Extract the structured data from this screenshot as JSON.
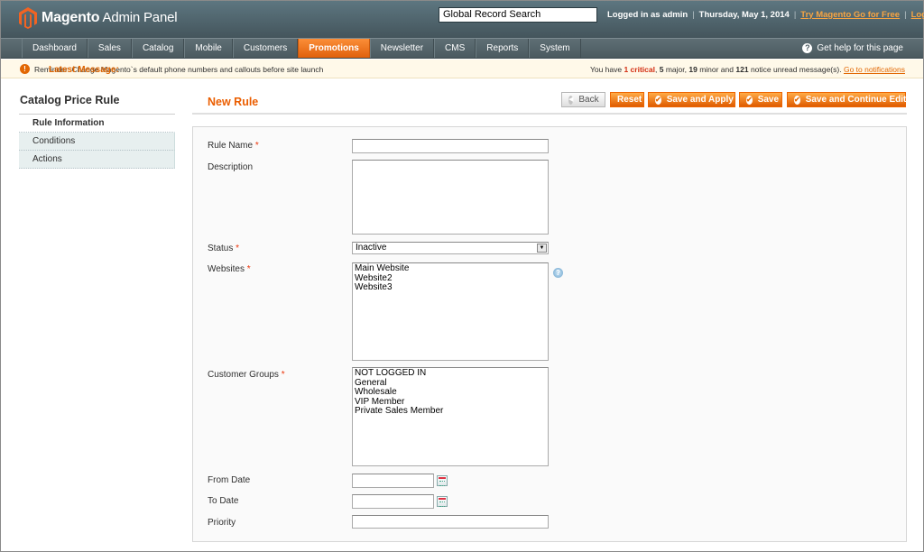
{
  "header": {
    "logo_brand": "Magento",
    "logo_suffix": "Admin Panel",
    "search_value": "Global Record Search",
    "logged_in": "Logged in as admin",
    "date": "Thursday, May 1, 2014",
    "try_link": "Try Magento Go for Free",
    "logout": "Log Out",
    "brand_color": "#eb5e00"
  },
  "nav": {
    "items": [
      "Dashboard",
      "Sales",
      "Catalog",
      "Mobile",
      "Customers",
      "Promotions",
      "Newsletter",
      "CMS",
      "Reports",
      "System"
    ],
    "active": "Promotions",
    "help": "Get help for this page"
  },
  "notice": {
    "label": "Latest Message:",
    "message": "Reminder: Change Magento`s default phone numbers and callouts before site launch",
    "summary_prefix": "You have",
    "critical_count": "1 critical",
    "major_count": "5",
    "major_label": "major,",
    "minor_count": "19",
    "minor_label": "minor and",
    "notice_count": "121",
    "notice_label": "notice unread message(s).",
    "link": "Go to notifications"
  },
  "sidebar": {
    "title": "Catalog Price Rule",
    "tabs": [
      "Rule Information",
      "Conditions",
      "Actions"
    ]
  },
  "content": {
    "title": "New Rule",
    "buttons": {
      "back": "Back",
      "reset": "Reset",
      "save_apply": "Save and Apply",
      "save": "Save",
      "save_continue": "Save and Continue Edit"
    }
  },
  "form": {
    "rule_name_label": "Rule Name",
    "description_label": "Description",
    "status_label": "Status",
    "status_value": "Inactive",
    "websites_label": "Websites",
    "websites_options": [
      "Main Website",
      "Website2",
      "Website3"
    ],
    "customer_groups_label": "Customer Groups",
    "customer_groups_options": [
      "NOT LOGGED IN",
      "General",
      "Wholesale",
      "VIP Member",
      "Private Sales Member"
    ],
    "from_date_label": "From Date",
    "to_date_label": "To Date",
    "priority_label": "Priority",
    "required_mark": "*"
  }
}
